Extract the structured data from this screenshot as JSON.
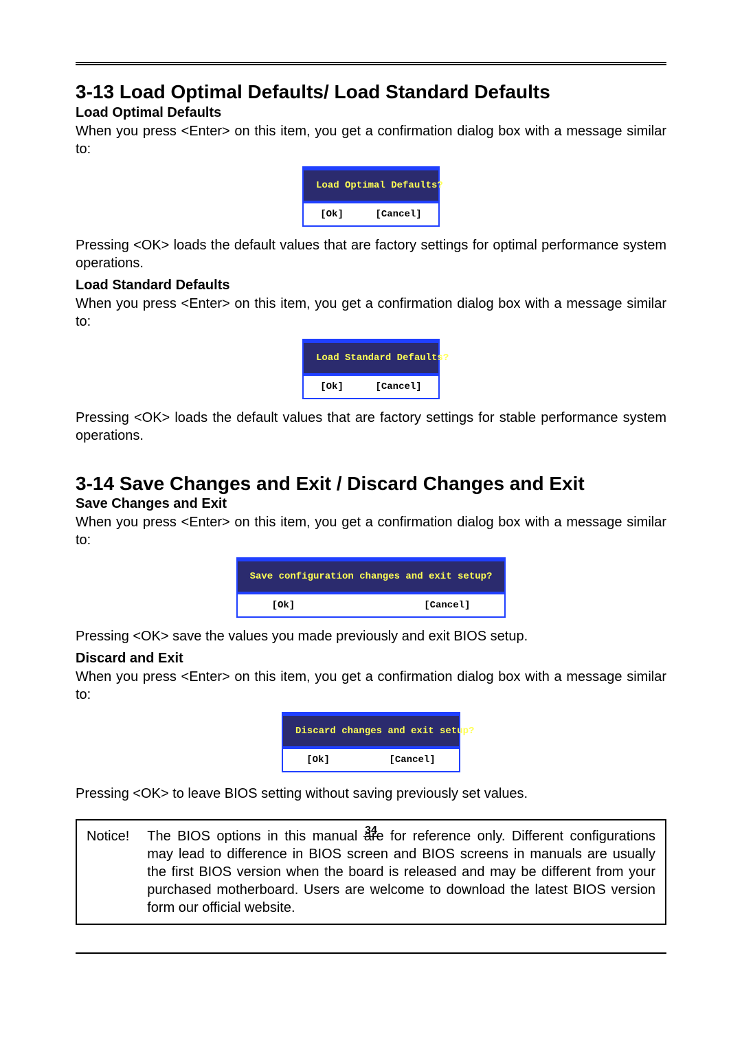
{
  "section313": {
    "title": "3-13 Load Optimal Defaults/ Load Standard Defaults",
    "optimal": {
      "heading": "Load Optimal Defaults",
      "intro": "When you press <Enter> on this item, you get a confirmation dialog box with a message similar to:",
      "dialog": {
        "message": "Load Optimal Defaults?",
        "ok": "[Ok]",
        "cancel": "[Cancel]"
      },
      "after": "Pressing <OK> loads the default values that are factory settings for optimal performance system operations."
    },
    "standard": {
      "heading": "Load Standard Defaults",
      "intro": "When you press <Enter> on this item, you get a confirmation dialog box with a message similar to:",
      "dialog": {
        "message": "Load Standard Defaults?",
        "ok": "[Ok]",
        "cancel": "[Cancel]"
      },
      "after": "Pressing <OK> loads the default values that are factory settings for stable performance system operations."
    }
  },
  "section314": {
    "title": "3-14 Save Changes and Exit / Discard Changes and Exit",
    "save": {
      "heading": "Save Changes and Exit",
      "intro": "When you press <Enter> on this item, you get a confirmation dialog box with a message similar to:",
      "dialog": {
        "message": "Save configuration changes and exit setup?",
        "ok": "[Ok]",
        "cancel": "[Cancel]"
      },
      "after": "Pressing <OK> save the values you made previously and exit BIOS setup."
    },
    "discard": {
      "heading": "Discard and Exit",
      "intro": "When you press <Enter> on this item, you get a confirmation dialog box with a message similar to:",
      "dialog": {
        "message": "Discard changes and exit setup?",
        "ok": "[Ok]",
        "cancel": "[Cancel]"
      },
      "after": "Pressing <OK> to leave BIOS setting without saving previously set values."
    }
  },
  "notice": {
    "label": "Notice!",
    "body": "The BIOS options in this manual are for reference only. Different configurations may lead to difference in BIOS screen and BIOS screens in manuals are usually the first BIOS version when the board is released and may be different from your purchased motherboard. Users are welcome to download the latest BIOS version form our official website."
  },
  "page_number": "34"
}
